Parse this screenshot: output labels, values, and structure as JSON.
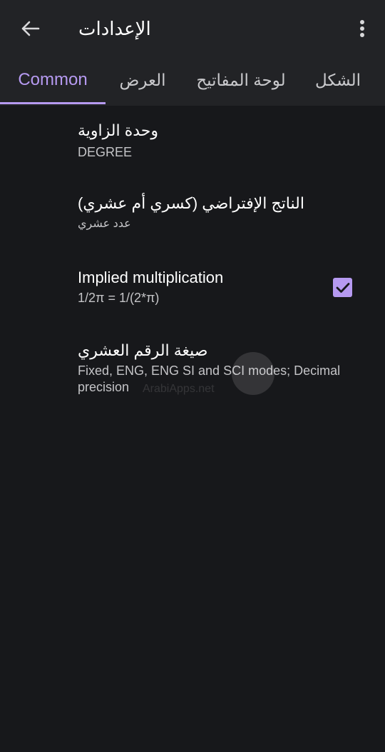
{
  "appbar": {
    "title": "الإعدادات",
    "back_icon": "arrow-left-icon",
    "menu_icon": "more-vertical-icon"
  },
  "tabs": [
    {
      "label": "Common",
      "active": true
    },
    {
      "label": "العرض",
      "active": false
    },
    {
      "label": "لوحة المفاتيح",
      "active": false
    },
    {
      "label": "الشكل",
      "active": false
    }
  ],
  "preferences": {
    "angle_unit": {
      "title": "وحدة الزاوية",
      "summary": "DEGREE"
    },
    "default_result": {
      "title": "الناتج الإفتراضي (كسري أم عشري)",
      "summary": "عدد عشري"
    },
    "implied_multiplication": {
      "title": "Implied multiplication",
      "summary": "1/2π = 1/(2*π)",
      "checked": true
    },
    "decimal_format": {
      "title": "صيغة الرقم العشري",
      "summary": "Fixed, ENG, ENG SI and SCI modes; Decimal precision"
    }
  },
  "watermark": {
    "text": "ArabiApps.net"
  },
  "colors": {
    "accent": "#b69af1",
    "background": "#17181b",
    "bar": "#222326"
  }
}
